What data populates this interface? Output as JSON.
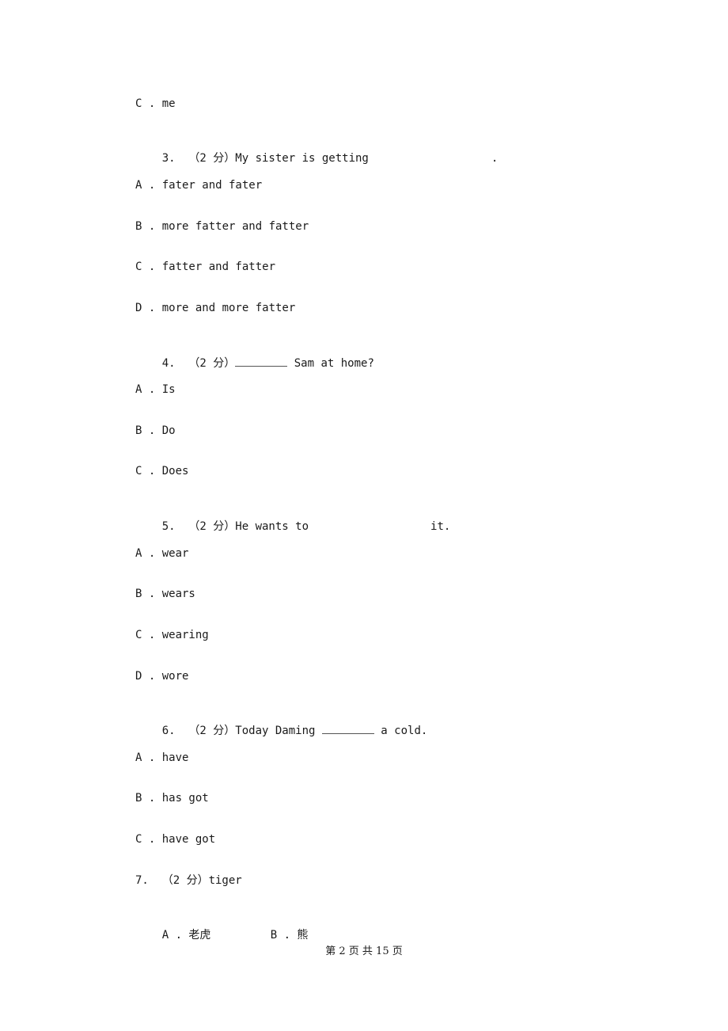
{
  "lines": {
    "l0": "C . me",
    "q3_prefix": "3.  （2 分）My sister is getting",
    "q3_suffix": ".",
    "q3a": "A . fater and fater",
    "q3b": "B . more fatter and fatter",
    "q3c": "C . fatter and fatter",
    "q3d": "D . more and more fatter",
    "q4_prefix": "4.  （2 分）",
    "q4_suffix": " Sam at home?",
    "q4a": "A . Is",
    "q4b": "B . Do",
    "q4c": "C . Does",
    "q5_prefix": "5.  （2 分）He wants to",
    "q5_suffix": "it.",
    "q5a": "A . wear",
    "q5b": "B . wears",
    "q5c": "C . wearing",
    "q5d": "D . wore",
    "q6_prefix": "6.  （2 分）Today Daming ",
    "q6_suffix": " a cold.",
    "q6a": "A . have",
    "q6b": "B . has got",
    "q6c": "C . have got",
    "q7": "7.  （2 分）tiger",
    "q7a": "A . 老虎",
    "q7b": "B . 熊"
  },
  "footer": {
    "page_label": "第 2 页 共 15 页"
  }
}
